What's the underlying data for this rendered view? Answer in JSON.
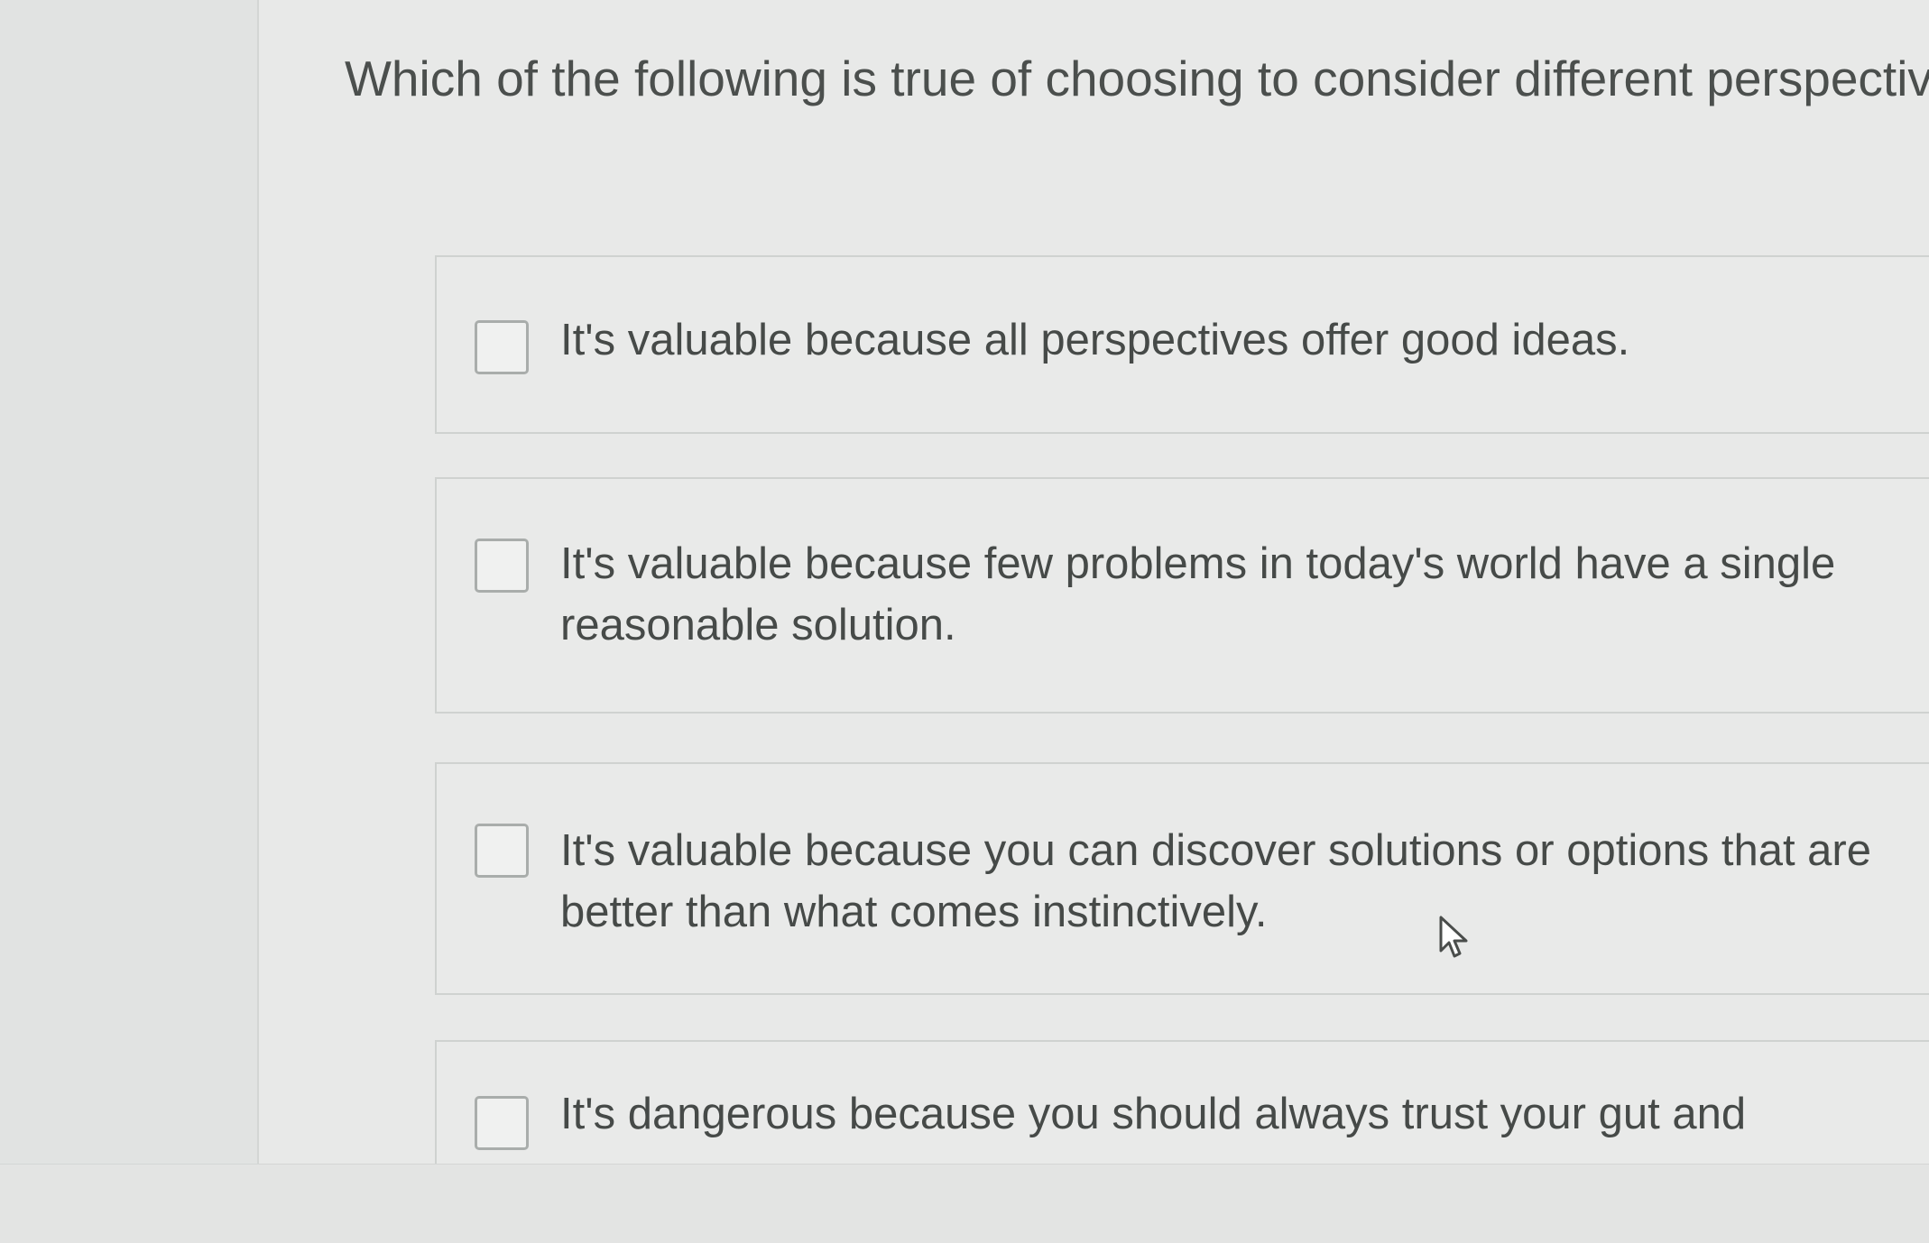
{
  "question": {
    "text": "Which of the following is true of choosing to consider different perspectives?"
  },
  "options": [
    {
      "label": "It's valuable because all perspectives offer good ideas.",
      "checked": false
    },
    {
      "label": "It's valuable because few problems in today's world have a single reasonable solution.",
      "checked": false
    },
    {
      "label": "It's valuable because you can discover solutions or options that are better than what comes instinctively.",
      "checked": false
    },
    {
      "label": "It's dangerous because you should always trust your gut and",
      "checked": false
    }
  ],
  "icons": {
    "checkbox": "checkbox-icon",
    "cursor": "mouse-pointer-icon"
  }
}
